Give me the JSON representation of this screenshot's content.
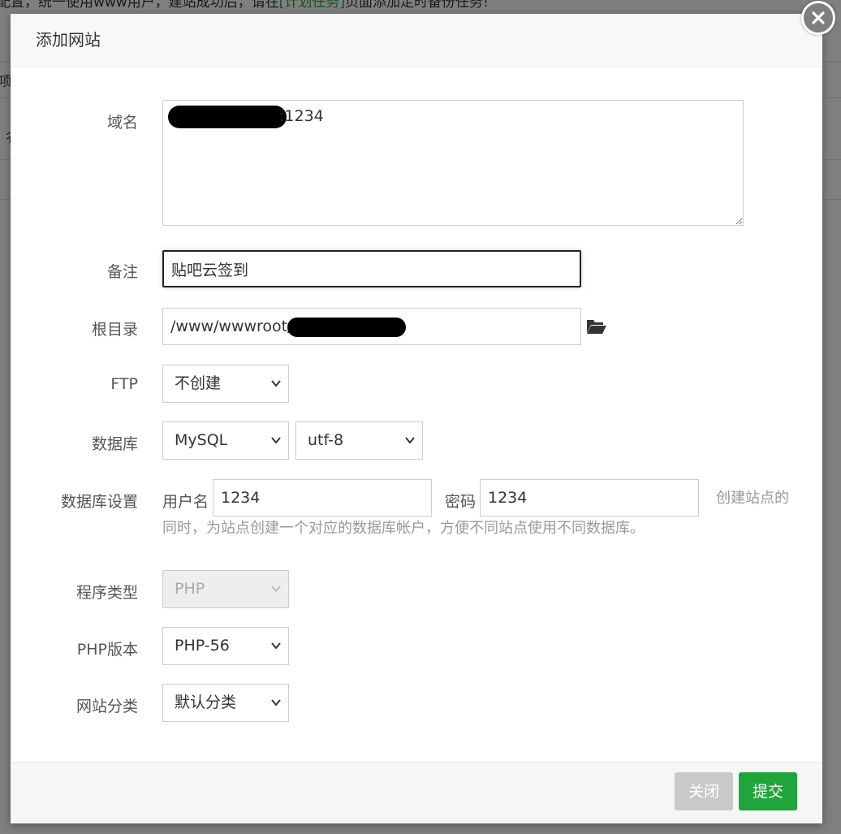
{
  "background": {
    "notice_pre": "配置，统一使用www用户，建站成功后，请在",
    "notice_link": "[计划任务]",
    "notice_post": "页面添加定时备份任务!",
    "frag_a": "项",
    "frag_b": "彳"
  },
  "dialog": {
    "title": "添加网站",
    "domain": {
      "label": "域名",
      "value": ":1234"
    },
    "remark": {
      "label": "备注",
      "value": "贴吧云签到"
    },
    "root": {
      "label": "根目录",
      "value": "/www/wwwroot/"
    },
    "ftp": {
      "label": "FTP",
      "selected": "不创建"
    },
    "database": {
      "label": "数据库",
      "type_selected": "MySQL",
      "charset_selected": "utf-8"
    },
    "db_settings": {
      "label": "数据库设置",
      "username_label": "用户名",
      "username_value": "1234",
      "password_label": "密码",
      "password_value": "1234",
      "help_line1": "创建站点的",
      "help_line2": "同时，为站点创建一个对应的数据库帐户，方便不同站点使用不同数据库。"
    },
    "program_type": {
      "label": "程序类型",
      "selected": "PHP"
    },
    "php_version": {
      "label": "PHP版本",
      "selected": "PHP-56"
    },
    "site_category": {
      "label": "网站分类",
      "selected": "默认分类"
    },
    "footer": {
      "close_label": "关闭",
      "submit_label": "提交"
    }
  },
  "colors": {
    "accent": "#20a53a",
    "close_button": "#c9c9c9"
  },
  "icons": {
    "close": "close-icon",
    "folder": "folder-open-icon",
    "chevron": "chevron-down-icon"
  }
}
